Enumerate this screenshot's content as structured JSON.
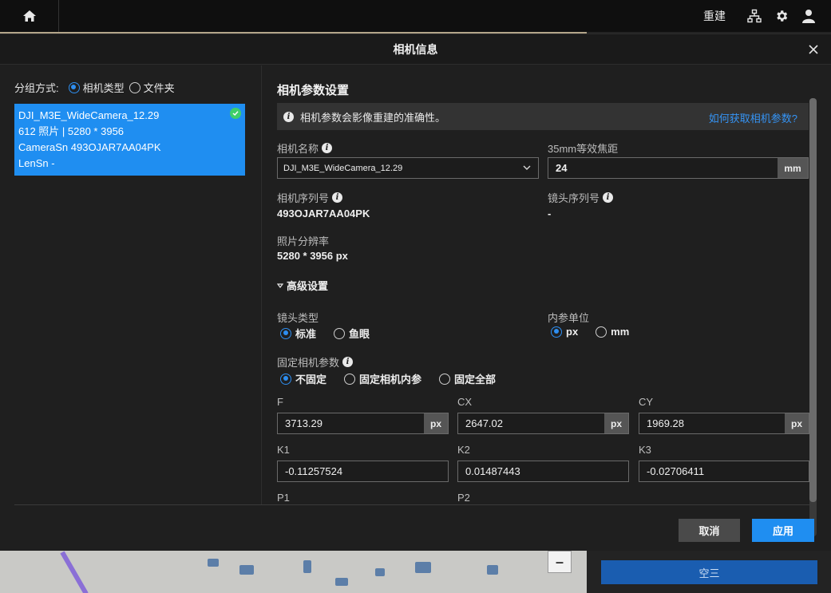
{
  "topbar": {
    "title": "重建",
    "icons": [
      "home-icon",
      "network-icon",
      "gear-icon",
      "user-icon"
    ]
  },
  "background": {
    "aerial_button": "空三"
  },
  "modal": {
    "title": "相机信息",
    "grouping": {
      "label": "分组方式:",
      "options": [
        "相机类型",
        "文件夹"
      ],
      "selected": "相机类型"
    },
    "camera_card": {
      "name": "DJI_M3E_WideCamera_12.29",
      "summary": "612 照片 | 5280 * 3956",
      "camera_sn": "CameraSn 493OJAR7AA04PK",
      "lens_sn": "LenSn -"
    },
    "settings": {
      "section_title": "相机参数设置",
      "info_text": "相机参数会影像重建的准确性。",
      "info_link": "如何获取相机参数?",
      "camera_name_label": "相机名称",
      "camera_name_value": "DJI_M3E_WideCamera_12.29",
      "focal_label": "35mm等效焦距",
      "focal_value": "24",
      "focal_unit": "mm",
      "camera_sn_label": "相机序列号",
      "camera_sn_value": "493OJAR7AA04PK",
      "lens_sn_label": "镜头序列号",
      "lens_sn_value": "-",
      "resolution_label": "照片分辨率",
      "resolution_value": "5280 * 3956 px",
      "advanced_label": "高级设置",
      "lens_type_label": "镜头类型",
      "lens_type_options": [
        "标准",
        "鱼眼"
      ],
      "lens_type_selected": "标准",
      "intrinsic_unit_label": "内参单位",
      "intrinsic_unit_options": [
        "px",
        "mm"
      ],
      "intrinsic_unit_selected": "px",
      "fix_params_label": "固定相机参数",
      "fix_params_options": [
        "不固定",
        "固定相机内参",
        "固定全部"
      ],
      "fix_params_selected": "不固定",
      "params": {
        "F": {
          "label": "F",
          "value": "3713.29",
          "unit": "px"
        },
        "CX": {
          "label": "CX",
          "value": "2647.02",
          "unit": "px"
        },
        "CY": {
          "label": "CY",
          "value": "1969.28",
          "unit": "px"
        },
        "K1": {
          "label": "K1",
          "value": "-0.11257524"
        },
        "K2": {
          "label": "K2",
          "value": "0.01487443"
        },
        "K3": {
          "label": "K3",
          "value": "-0.02706411"
        },
        "P1": {
          "label": "P1"
        },
        "P2": {
          "label": "P2"
        }
      }
    },
    "buttons": {
      "cancel": "取消",
      "apply": "应用"
    }
  },
  "colors": {
    "accent": "#1f8ef1",
    "link": "#3594f5",
    "success": "#3fcf6a"
  }
}
